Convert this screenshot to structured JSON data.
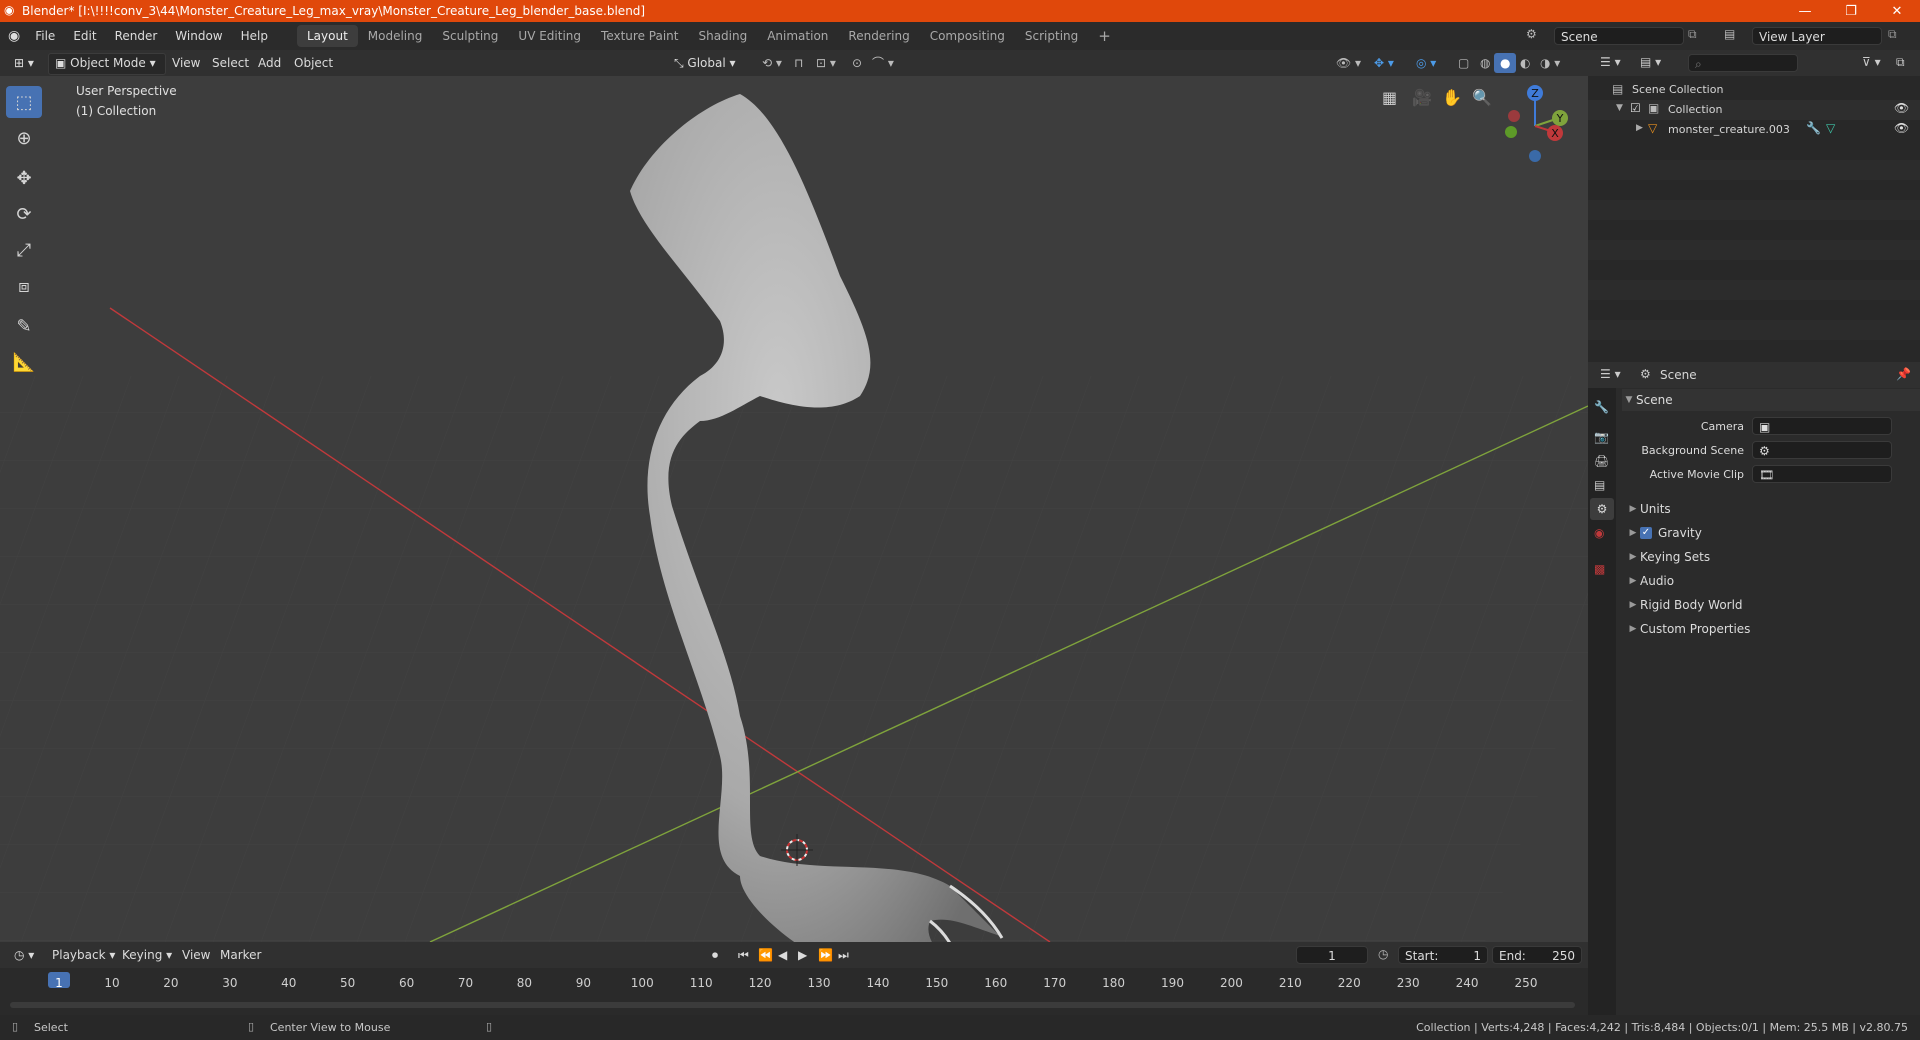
{
  "window": {
    "title": "Blender* [I:\\!!!!conv_3\\44\\Monster_Creature_Leg_max_vray\\Monster_Creature_Leg_blender_base.blend]",
    "controls": {
      "minimize": "—",
      "maximize": "❐",
      "close": "✕"
    }
  },
  "menu": {
    "items": [
      "File",
      "Edit",
      "Render",
      "Window",
      "Help"
    ]
  },
  "workspaces": {
    "tabs": [
      "Layout",
      "Modeling",
      "Sculpting",
      "UV Editing",
      "Texture Paint",
      "Shading",
      "Animation",
      "Rendering",
      "Compositing",
      "Scripting"
    ],
    "active": "Layout",
    "add": "+"
  },
  "scene_field": "Scene",
  "view_layer_field": "View Layer",
  "viewport_header": {
    "mode": "Object Mode",
    "menus": [
      "View",
      "Select",
      "Add",
      "Object"
    ],
    "orientation": "Global"
  },
  "viewport": {
    "perspective_label": "User Perspective",
    "collection_label": "(1) Collection",
    "gizmo": {
      "z": "Z",
      "y": "Y",
      "x": "X"
    }
  },
  "outliner": {
    "search_placeholder": "",
    "scene_collection": "Scene Collection",
    "collection": "Collection",
    "object": "monster_creature.003"
  },
  "properties": {
    "header_title": "Scene",
    "panel_title": "Scene",
    "camera_label": "Camera",
    "background_scene_label": "Background Scene",
    "active_movie_clip_label": "Active Movie Clip",
    "sections": [
      "Units",
      "Gravity",
      "Keying Sets",
      "Audio",
      "Rigid Body World",
      "Custom Properties"
    ],
    "gravity_checked": true
  },
  "timeline": {
    "menus": [
      "Playback",
      "Keying",
      "View",
      "Marker"
    ],
    "current_frame": "1",
    "start_label": "Start:",
    "start": "1",
    "end_label": "End:",
    "end": "250",
    "ticks": [
      "1",
      "10",
      "20",
      "30",
      "40",
      "50",
      "60",
      "70",
      "80",
      "90",
      "100",
      "110",
      "120",
      "130",
      "140",
      "150",
      "160",
      "170",
      "180",
      "190",
      "200",
      "210",
      "220",
      "230",
      "240",
      "250"
    ]
  },
  "statusbar": {
    "left": "Select",
    "middle": "Center View to Mouse",
    "right": "Collection | Verts:4,248 | Faces:4,242 | Tris:8,484 | Objects:0/1 | Mem: 25.5 MB | v2.80.75"
  },
  "colors": {
    "title_bar": "#e0480b",
    "accent_blue": "#4772b3",
    "axis_x": "#c0393b",
    "axis_y": "#7fa33c",
    "axis_z": "#3f7bd9"
  }
}
